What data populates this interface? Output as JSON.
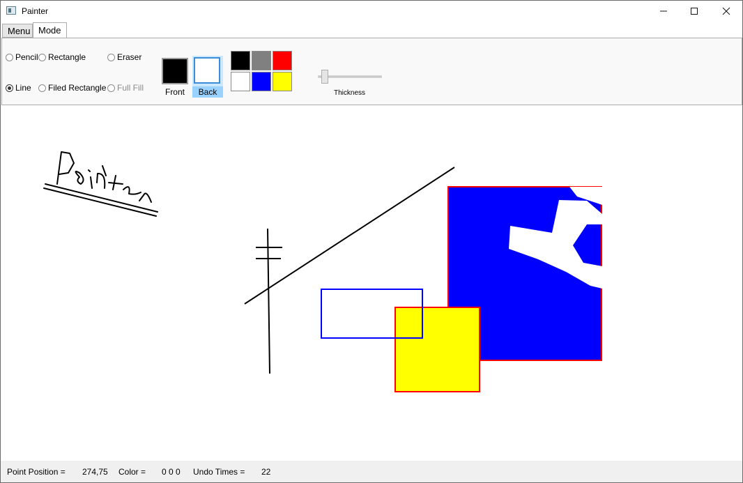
{
  "window": {
    "title": "Painter"
  },
  "tabs": [
    {
      "label": "Menu"
    },
    {
      "label": "Mode"
    }
  ],
  "modes": {
    "pencil": "Pencil",
    "rectangle": "Rectangle",
    "eraser": "Eraser",
    "line": "Line",
    "filled_rectangle": "Filed Rectangle",
    "full_fill": "Full Fill",
    "selected": "Line"
  },
  "colors": {
    "front_label": "Front",
    "back_label": "Back",
    "front_color": "#000000",
    "back_color": "#ffffff",
    "palette": [
      "#000000",
      "#808080",
      "#ff0000",
      "#ffffff",
      "#0000ff",
      "#ffff00"
    ]
  },
  "thickness": {
    "label": "Thickness",
    "level": 0.05
  },
  "canvas": {
    "handwriting": "Painter"
  },
  "status": {
    "point_label": "Point Position =",
    "point_value": "274,75",
    "color_label": "Color =",
    "color_value": "0 0 0",
    "undo_label": "Undo Times =",
    "undo_value": "22"
  }
}
